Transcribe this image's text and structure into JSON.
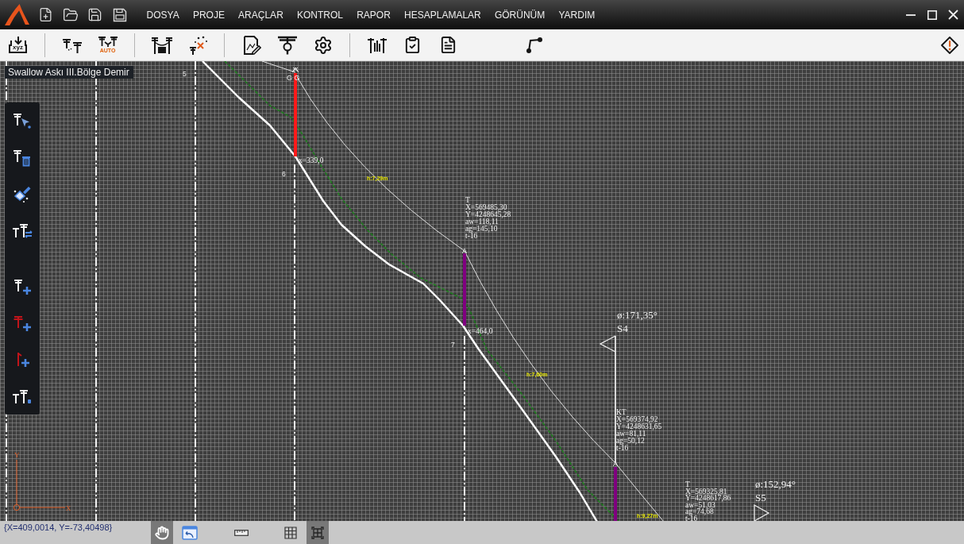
{
  "menu_bar": {
    "menus": [
      "DOSYA",
      "PROJE",
      "ARAÇLAR",
      "KONTROL",
      "RAPOR",
      "HESAPLAMALAR",
      "GÖRÜNÜM",
      "YARDIM"
    ]
  },
  "toolbar": {
    "import_label": "xyz",
    "auto_badge": "AUTO"
  },
  "canvas": {
    "layer_label": "Swallow Askı III.Bölge Demir",
    "pole_numbers": [
      "5",
      "6",
      "7"
    ],
    "poles": [
      {
        "color": "#ff1a1a",
        "top_label": "G G",
        "ground_reading": "x=339,0"
      },
      {
        "color": "#800080",
        "top_label": "A",
        "ground_reading": "x=464,0"
      },
      {
        "color": "#800080",
        "top_label": "A"
      }
    ],
    "span_labels": [
      "h:7,29m",
      "h:7,60m",
      "h:9,27m"
    ],
    "pole_info": [
      {
        "lines": [
          "T",
          "X=569485,30",
          "Y=4248645,28",
          "aw=118,11",
          "ag=145,10",
          "t-16"
        ]
      },
      {
        "lines": [
          "KT",
          "X=569374,92",
          "Y=4248631,65",
          "aw=81,11",
          "ag=50,12",
          "t-16"
        ]
      },
      {
        "lines": [
          "T",
          "X=569325,81",
          "Y=4248617,86",
          "aw=51,03",
          "ag=74,68",
          "t-16"
        ]
      }
    ],
    "stations": [
      {
        "angle": "ø:171,35°",
        "name": "S4",
        "kind": "left"
      },
      {
        "angle": "ø:152,94°",
        "name": "S5",
        "kind": "right"
      }
    ],
    "axis_labels": {
      "x": "X",
      "y": "Y"
    }
  },
  "status_bar": {
    "coordinates": "{X=409,0014, Y=-73,40498}",
    "tools": [
      {
        "kind": "pan",
        "selected": true
      },
      {
        "kind": "window",
        "selected": false
      },
      {
        "kind": "ruler",
        "selected": false
      },
      {
        "kind": "grid",
        "selected": false
      },
      {
        "kind": "frame",
        "selected": true
      }
    ]
  }
}
